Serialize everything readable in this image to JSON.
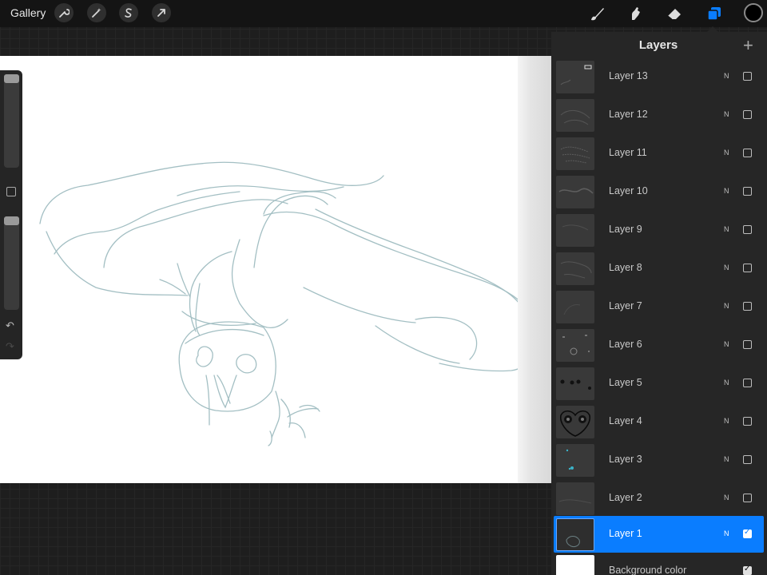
{
  "topbar": {
    "gallery_label": "Gallery",
    "left_tools": [
      "wrench-icon",
      "magic-wand-icon",
      "selection-icon",
      "transform-arrow-icon"
    ],
    "right_tools": [
      "brush-icon",
      "smudge-icon",
      "eraser-icon",
      "layers-icon"
    ],
    "current_color": "#000000",
    "accent_color": "#0a7dff"
  },
  "layers_panel": {
    "title": "Layers",
    "add_button": "+",
    "layers": [
      {
        "name": "Layer 13",
        "blend": "N",
        "visible": false,
        "active": false
      },
      {
        "name": "Layer 12",
        "blend": "N",
        "visible": false,
        "active": false
      },
      {
        "name": "Layer 11",
        "blend": "N",
        "visible": false,
        "active": false
      },
      {
        "name": "Layer 10",
        "blend": "N",
        "visible": false,
        "active": false
      },
      {
        "name": "Layer 9",
        "blend": "N",
        "visible": false,
        "active": false
      },
      {
        "name": "Layer 8",
        "blend": "N",
        "visible": false,
        "active": false
      },
      {
        "name": "Layer 7",
        "blend": "N",
        "visible": false,
        "active": false
      },
      {
        "name": "Layer 6",
        "blend": "N",
        "visible": false,
        "active": false
      },
      {
        "name": "Layer 5",
        "blend": "N",
        "visible": false,
        "active": false
      },
      {
        "name": "Layer 4",
        "blend": "N",
        "visible": false,
        "active": false
      },
      {
        "name": "Layer 3",
        "blend": "N",
        "visible": false,
        "active": false
      },
      {
        "name": "Layer 2",
        "blend": "N",
        "visible": false,
        "active": false
      },
      {
        "name": "Layer 1",
        "blend": "N",
        "visible": true,
        "active": true
      }
    ],
    "background_layer": {
      "name": "Background color",
      "visible": true
    }
  },
  "sidebar": {
    "undo_label": "↶",
    "redo_label": "↷"
  }
}
